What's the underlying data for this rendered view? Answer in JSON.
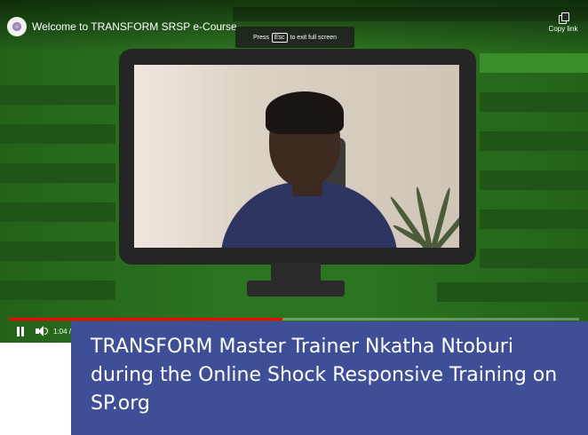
{
  "video": {
    "title": "Welcome to TRANSFORM SRSP e-Course",
    "copy_link_label": "Copy link",
    "fullscreen_hint_prefix": "Press",
    "fullscreen_hint_key": "Esc",
    "fullscreen_hint_suffix": "to exit full screen",
    "time_label": "1:04 /",
    "progress_fraction": 0.48,
    "progress_color": "#ff0000",
    "background_color": "#2f7a1e",
    "icons": {
      "channel": "channel-avatar-icon",
      "copy": "copy-link-icon",
      "play_state": "pause-icon",
      "volume": "volume-icon"
    }
  },
  "caption": {
    "text": "TRANSFORM Master Trainer Nkatha Ntoburi during the Online Shock Responsive Training on SP.org",
    "background_color": "#3f4f97"
  }
}
